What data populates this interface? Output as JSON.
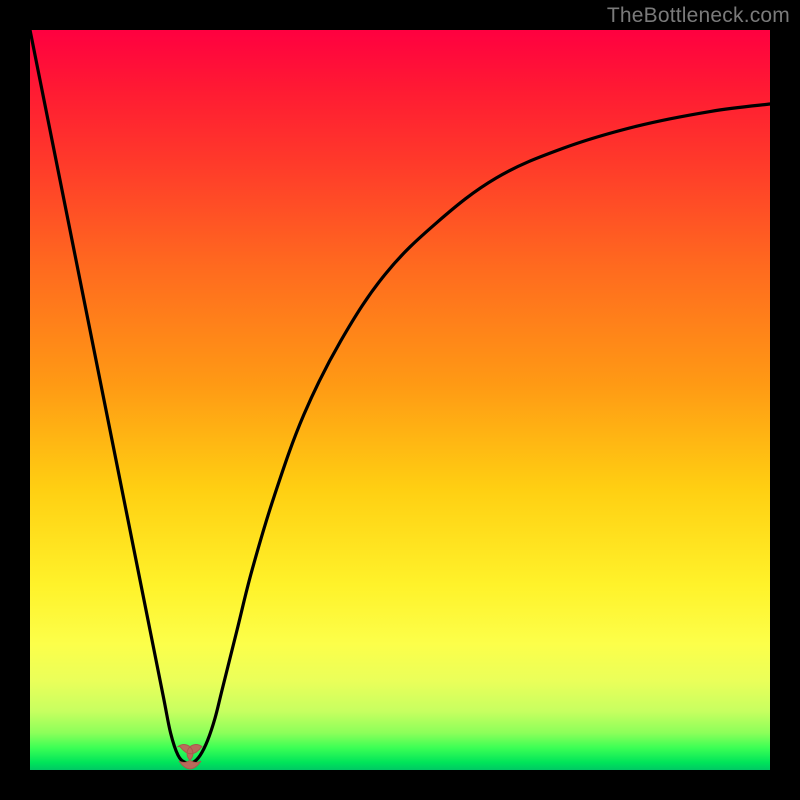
{
  "watermark": "TheBottleneck.com",
  "colors": {
    "frame": "#000000",
    "curve_stroke": "#000000",
    "marker_fill": "#b96a5b",
    "marker_stroke": "#a95a4d"
  },
  "chart_data": {
    "type": "line",
    "title": "",
    "xlabel": "",
    "ylabel": "",
    "xlim": [
      0,
      100
    ],
    "ylim": [
      0,
      100
    ],
    "grid": false,
    "legend": false,
    "series": [
      {
        "name": "bottleneck-curve",
        "x": [
          0,
          2,
          4,
          6,
          8,
          10,
          12,
          14,
          16,
          18,
          19,
          20,
          21,
          22,
          23,
          24,
          25,
          26,
          28,
          30,
          33,
          37,
          42,
          48,
          55,
          63,
          72,
          82,
          92,
          100
        ],
        "values": [
          100,
          90,
          80,
          70,
          60,
          50,
          40,
          30,
          20,
          10,
          5,
          2,
          1,
          1,
          2,
          4,
          7,
          11,
          19,
          27,
          37,
          48,
          58,
          67,
          74,
          80,
          84,
          87,
          89,
          90
        ]
      }
    ],
    "minimum_marker": {
      "x": 21.5,
      "y": 1
    }
  }
}
